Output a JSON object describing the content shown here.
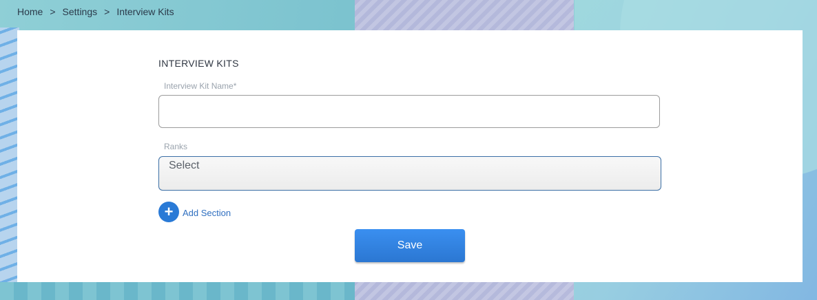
{
  "breadcrumb": {
    "items": [
      "Home",
      "Settings",
      "Interview Kits"
    ],
    "separator": ">"
  },
  "form": {
    "section_title": "INTERVIEW KITS",
    "kit_name": {
      "label": "Interview Kit Name*",
      "value": "",
      "placeholder": ""
    },
    "ranks": {
      "label": "Ranks",
      "selected": "Select"
    },
    "add_section_label": "Add Section",
    "add_section_icon": "plus-icon",
    "save_label": "Save"
  },
  "colors": {
    "primary": "#2b7ad6",
    "link": "#2f6fc0"
  }
}
